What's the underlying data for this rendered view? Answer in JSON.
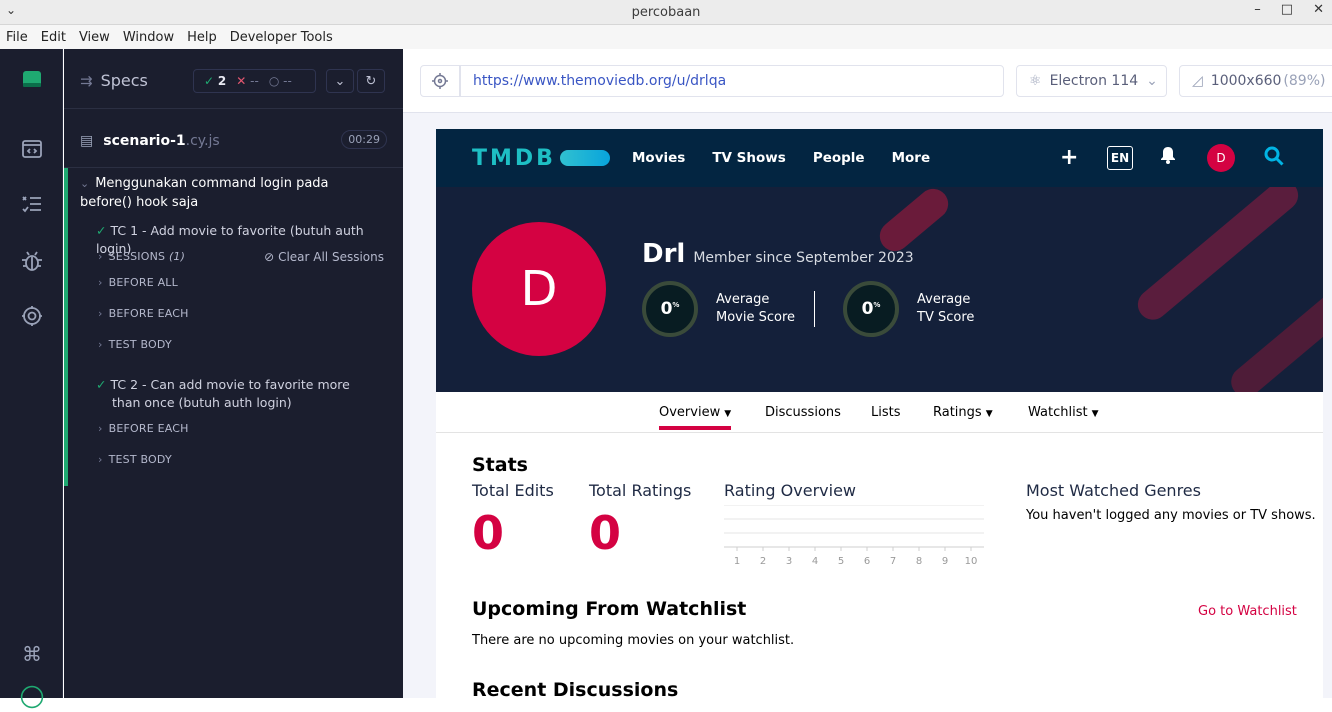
{
  "window": {
    "title": "percobaan",
    "controls": [
      "–",
      "□",
      "✕"
    ]
  },
  "menu": [
    "File",
    "Edit",
    "View",
    "Window",
    "Help",
    "Developer Tools"
  ],
  "specs": {
    "title": "Specs",
    "passed": "2",
    "failed": "--",
    "pending": "--",
    "file_name": "scenario-1",
    "file_ext": ".cy.js",
    "duration": "00:29",
    "suite_title": "Menggunakan command login pada before() hook saja",
    "clear_sessions": "Clear All Sessions",
    "tests": [
      {
        "title": "TC 1 - Add movie to favorite (butuh auth login)",
        "sections": [
          "SESSIONS",
          "BEFORE ALL",
          "BEFORE EACH",
          "TEST BODY"
        ],
        "sessions_count": "(1)"
      },
      {
        "title": "TC 2 - Can add movie to favorite more than once (butuh auth login)",
        "sections": [
          "BEFORE EACH",
          "TEST BODY"
        ]
      }
    ]
  },
  "browser": {
    "url": "https://www.themoviedb.org/u/drlqa",
    "engine": "Electron 114",
    "viewport": "1000x660",
    "zoom": "(89%)"
  },
  "tmdb": {
    "logo": "TMDB",
    "nav_links": [
      "Movies",
      "TV Shows",
      "People",
      "More"
    ],
    "lang": "EN",
    "avatar_letter": "D",
    "username": "Drl",
    "member_since": "Member since September 2023",
    "movie_score": "0",
    "movie_score_label_1": "Average",
    "movie_score_label_2": "Movie Score",
    "tv_score": "0",
    "tv_score_label_1": "Average",
    "tv_score_label_2": "TV Score",
    "percent_sign": "%",
    "tabs": [
      "Overview",
      "Discussions",
      "Lists",
      "Ratings",
      "Watchlist"
    ],
    "stats_title": "Stats",
    "total_edits_label": "Total Edits",
    "total_edits": "0",
    "total_ratings_label": "Total Ratings",
    "total_ratings": "0",
    "rating_overview_label": "Rating Overview",
    "rating_ticks": [
      "1",
      "2",
      "3",
      "4",
      "5",
      "6",
      "7",
      "8",
      "9",
      "10"
    ],
    "genres_title": "Most Watched Genres",
    "genres_text": "You haven't logged any movies or TV shows.",
    "upcoming_title": "Upcoming From Watchlist",
    "upcoming_text": "There are no upcoming movies on your watchlist.",
    "go_to_watchlist": "Go to Watchlist",
    "recent_discussions": "Recent Discussions"
  },
  "colors": {
    "tmdb_navy": "#032541",
    "tmdb_red": "#d40242",
    "cypress_green": "#1fa971",
    "cypress_dark": "#1b1e2e"
  }
}
